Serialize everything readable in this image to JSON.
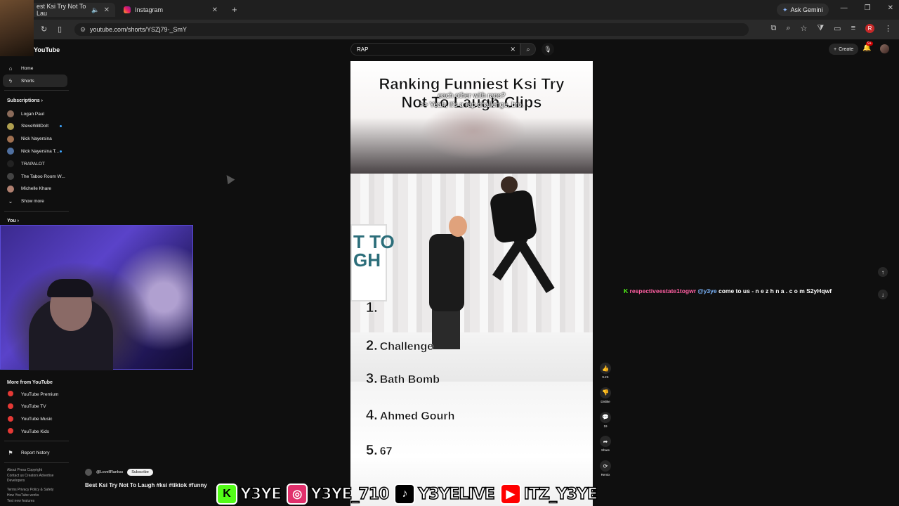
{
  "browser": {
    "tabs": [
      {
        "label": "est Ksi Try Not To Lau"
      },
      {
        "label": "Instagram"
      }
    ],
    "url": "youtube.com/shorts/YSZj79-_SmY",
    "ask_gemini": "Ask Gemini",
    "profile_initial": "R"
  },
  "youtube": {
    "logo": "YouTube",
    "search_value": "RAP",
    "create_label": "Create",
    "notif_badge": "9+",
    "sidebar": {
      "home": "Home",
      "shorts": "Shorts",
      "subscriptions_heading": "Subscriptions",
      "subscriptions": [
        {
          "name": "Logan Paul",
          "color": "#8b6b5a",
          "live": false
        },
        {
          "name": "SteveWillDoIt",
          "color": "#b0a050",
          "live": true
        },
        {
          "name": "Nick Nayersina",
          "color": "#a07050",
          "live": false
        },
        {
          "name": "Nick Nayersina T...",
          "color": "#5070a0",
          "live": true
        },
        {
          "name": "TRAPALOT",
          "color": "#222222",
          "live": false
        },
        {
          "name": "The Taboo Room W...",
          "color": "#444444",
          "live": false
        },
        {
          "name": "Michelle Khare",
          "color": "#b08070",
          "live": false
        }
      ],
      "show_more": "Show more",
      "you_heading": "You",
      "more_heading": "More from YouTube",
      "more_items": [
        "YouTube Premium",
        "YouTube TV",
        "YouTube Music",
        "YouTube Kids"
      ],
      "report_history": "Report history",
      "footer": [
        "About  Press  Copyright",
        "Contact us  Creators  Advertise",
        "Developers",
        "",
        "Terms  Privacy  Policy & Safety",
        "How YouTube works",
        "Test new features"
      ]
    },
    "short": {
      "title_line1": "Ranking Funniest Ksi Try",
      "title_line2": "Not To Laugh Clips",
      "caption1": "each other with raps?",
      "caption2": ">> Yeah, it's a rap challenge, bro.",
      "sign_text": "T TO\nGH",
      "rank1": "1.",
      "ranks": [
        {
          "num": "2.",
          "label": "Challenge"
        },
        {
          "num": "3.",
          "label": "Bath Bomb"
        },
        {
          "num": "4.",
          "label": "Ahmed Gourh"
        },
        {
          "num": "5.",
          "label": "67"
        }
      ],
      "channel": "@LovellRankss",
      "subscribe": "Subscribe",
      "video_title": "Best Ksi Try Not To Laugh #ksi #tiktok #funny",
      "actions": {
        "likes": "9.2K",
        "dislike": "Dislike",
        "comments": "19",
        "share": "Share",
        "remix": "Remix"
      }
    }
  },
  "chat_message": {
    "user": "respectiveestate1togwr",
    "mention": "@y3ye",
    "text": "come to us - n e z h n a . c o m S2yHqwf"
  },
  "socials": [
    {
      "icon": "kick-icon",
      "text": "Y3YE",
      "color": "#53fc18"
    },
    {
      "icon": "instagram-icon",
      "text": "Y3YE_710",
      "color": "#e1306c"
    },
    {
      "icon": "tiktok-icon",
      "text": "Y3YELIVE",
      "color": "#000000"
    },
    {
      "icon": "youtube-icon",
      "text": "ITZ_Y3YE",
      "color": "#ff0000"
    }
  ]
}
